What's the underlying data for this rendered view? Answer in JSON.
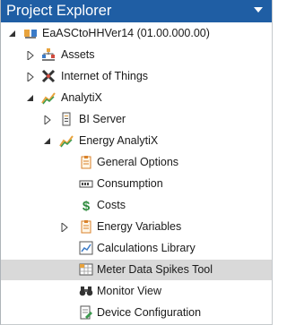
{
  "panel": {
    "title": "Project Explorer",
    "menu_icon": "dropdown-triangle-icon",
    "colors": {
      "titlebar": "#1f5ea4",
      "title_text": "#ffffff",
      "selection": "#d9d9d9"
    }
  },
  "tree": {
    "project": {
      "label": "EaASCtoHHVer14 (01.00.000.00)",
      "icon": "project-icon",
      "expanded": true
    },
    "assets": {
      "label": "Assets",
      "icon": "assets-icon",
      "expanded": false
    },
    "iot": {
      "label": "Internet of Things",
      "icon": "iot-icon",
      "expanded": false
    },
    "analytix": {
      "label": "AnalytiX",
      "icon": "analytix-icon",
      "expanded": true
    },
    "bi_server": {
      "label": "BI Server",
      "icon": "bi-server-icon",
      "expanded": false
    },
    "energy_analytix": {
      "label": "Energy AnalytiX",
      "icon": "energy-analytix-icon",
      "expanded": true
    },
    "general_options": {
      "label": "General Options",
      "icon": "clipboard-icon"
    },
    "consumption": {
      "label": "Consumption",
      "icon": "meter-icon"
    },
    "costs": {
      "label": "Costs",
      "icon": "dollar-icon"
    },
    "energy_variables": {
      "label": "Energy Variables",
      "icon": "variables-icon",
      "expanded": false
    },
    "calculations_library": {
      "label": "Calculations Library",
      "icon": "chart-icon"
    },
    "meter_data_spikes_tool": {
      "label": "Meter Data Spikes Tool",
      "icon": "spikes-tool-icon",
      "selected": true
    },
    "monitor_view": {
      "label": "Monitor View",
      "icon": "binoculars-icon"
    },
    "device_configuration": {
      "label": "Device Configuration",
      "icon": "device-config-icon"
    }
  }
}
